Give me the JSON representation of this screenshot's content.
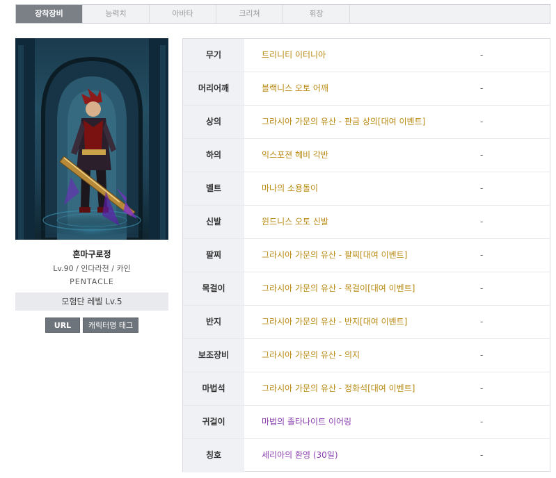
{
  "tabs": [
    {
      "label": "장착장비",
      "active": true
    },
    {
      "label": "능력치",
      "active": false
    },
    {
      "label": "아바타",
      "active": false
    },
    {
      "label": "크리쳐",
      "active": false
    },
    {
      "label": "휘장",
      "active": false
    }
  ],
  "character": {
    "name": "혼마구로정",
    "info": "Lv.90 / 인다라천 / 카인",
    "guild": "PENTACLE",
    "adventure_level": "모험단 레벨 Lv.5"
  },
  "buttons": {
    "url": "URL",
    "tag": "캐릭터명 태그"
  },
  "equipment": [
    {
      "slot": "무기",
      "item": "트리니티 이터니아",
      "option": "-",
      "color": "#b88a12"
    },
    {
      "slot": "머리어깨",
      "item": "블랙니스 오토 어깨",
      "option": "-",
      "color": "#b88a12"
    },
    {
      "slot": "상의",
      "item": "그라시아 가문의 유산 - 판금 상의[대여 이벤트]",
      "option": "-",
      "color": "#b88a12"
    },
    {
      "slot": "하의",
      "item": "익스포젼 헤비 각반",
      "option": "-",
      "color": "#b88a12"
    },
    {
      "slot": "벨트",
      "item": "마나의 소용돌이",
      "option": "-",
      "color": "#b88a12"
    },
    {
      "slot": "신발",
      "item": "윈드니스 오토 신발",
      "option": "-",
      "color": "#b88a12"
    },
    {
      "slot": "팔찌",
      "item": "그라시아 가문의 유산 - 팔찌[대여 이벤트]",
      "option": "-",
      "color": "#b88a12"
    },
    {
      "slot": "목걸이",
      "item": "그라시아 가문의 유산 - 목걸이[대여 이벤트]",
      "option": "-",
      "color": "#b88a12"
    },
    {
      "slot": "반지",
      "item": "그라시아 가문의 유산 - 반지[대여 이벤트]",
      "option": "-",
      "color": "#b88a12"
    },
    {
      "slot": "보조장비",
      "item": "그라시아 가문의 유산 - 의지",
      "option": "-",
      "color": "#b88a12"
    },
    {
      "slot": "마법석",
      "item": "그라시아 가문의 유산 - 정화석[대여 이벤트]",
      "option": "-",
      "color": "#b88a12"
    },
    {
      "slot": "귀걸이",
      "item": "마법의 졸타나이트 이어링",
      "option": "-",
      "color": "#8a3fae"
    },
    {
      "slot": "칭호",
      "item": "세리아의 환영 (30일)",
      "option": "-",
      "color": "#8a3fae"
    }
  ]
}
